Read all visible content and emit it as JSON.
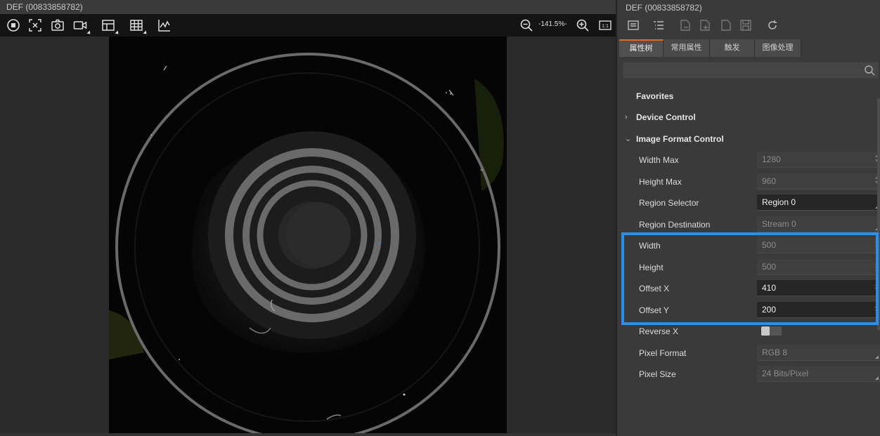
{
  "left": {
    "window_title": "DEF (00833858782)",
    "toolbar": {
      "icons": [
        "stop-icon",
        "fit-icon",
        "snapshot-icon",
        "record-icon",
        "grid-icon",
        "table-icon",
        "chart-icon"
      ],
      "zoom_level": "-141.5%-",
      "actual_size_label": "1:1"
    }
  },
  "right": {
    "window_title": "DEF (00833858782)",
    "tabs": [
      "属性树",
      "常用属性",
      "触发",
      "图像处理"
    ],
    "search": {
      "placeholder": ""
    },
    "tree": {
      "favorites": "Favorites",
      "device_control": "Device Control",
      "image_format_control": "Image Format Control",
      "properties": [
        {
          "label": "Width Max",
          "value": "1280"
        },
        {
          "label": "Height Max",
          "value": "960"
        },
        {
          "label": "Region Selector",
          "value": "Region 0"
        },
        {
          "label": "Region Destination",
          "value": "Stream 0"
        },
        {
          "label": "Width",
          "value": "500"
        },
        {
          "label": "Height",
          "value": "500"
        },
        {
          "label": "Offset X",
          "value": "410"
        },
        {
          "label": "Offset Y",
          "value": "200"
        },
        {
          "label": "Reverse X",
          "value": ""
        },
        {
          "label": "Pixel Format",
          "value": "RGB 8"
        },
        {
          "label": "Pixel Size",
          "value": "24 Bits/Pixel"
        }
      ]
    }
  },
  "colors": {
    "accent_tab": "#e06d1c",
    "highlight": "#2a8fe8"
  }
}
